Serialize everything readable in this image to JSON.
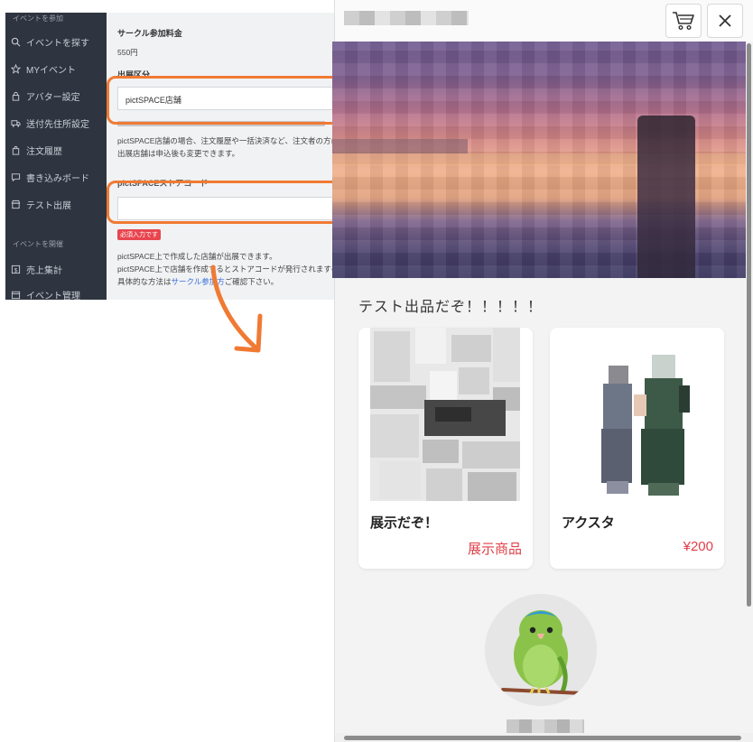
{
  "admin": {
    "sidebar": {
      "section_join": "イベントを参加",
      "items": [
        {
          "label": "イベントを探す",
          "icon": "search-icon"
        },
        {
          "label": "MYイベント",
          "icon": "star-icon"
        },
        {
          "label": "アバター設定",
          "icon": "lock-icon"
        },
        {
          "label": "送付先住所設定",
          "icon": "truck-icon"
        },
        {
          "label": "注文履歴",
          "icon": "bag-icon"
        },
        {
          "label": "書き込みボード",
          "icon": "chat-icon"
        },
        {
          "label": "テスト出展",
          "icon": "store-icon"
        }
      ],
      "section_host": "イベントを開催",
      "host_items": [
        {
          "label": "売上集計",
          "icon": "dollar-icon"
        },
        {
          "label": "イベント管理",
          "icon": "calendar-icon"
        }
      ]
    },
    "form": {
      "fee_label": "サークル参加料金",
      "fee_value": "550円",
      "type_label": "出展区分",
      "type_value": "pictSPACE店舗",
      "note1": "pictSPACE店舗の場合、注文履歴や一括決済など、注文者の方にとって便利な",
      "note2": "出展店舗は申込後も変更できます。",
      "store_code_label": "pictSPACEストアコード",
      "required_badge": "必須入力です",
      "help1": "pictSPACE上で作成した店舗が出展できます。",
      "help2": "pictSPACE上で店舗を作成するとストアコードが発行されますので、ストアコ",
      "help3_prefix": "具体的な方法は",
      "help3_link": "サークル参加方",
      "help3_suffix": "ご確認下さい。"
    }
  },
  "shop": {
    "section_title": "テスト出品だぞ！！！！！",
    "items": [
      {
        "title": "展示だぞ！",
        "price": "展示商品"
      },
      {
        "title": "アクスタ",
        "price": "¥200"
      }
    ],
    "header_icons": [
      "cart-icon",
      "close-icon"
    ]
  },
  "colors": {
    "highlight": "#f07a33",
    "price_red": "#e0404a",
    "sidebar_bg": "#2f3540"
  }
}
